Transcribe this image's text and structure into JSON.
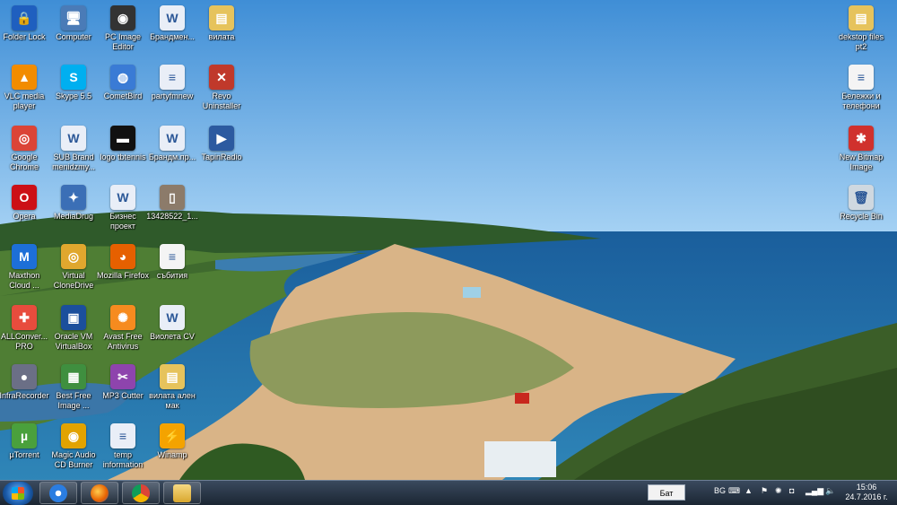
{
  "desktop": {
    "icons": [
      {
        "label": "Folder Lock",
        "icon": "folder-lock-icon",
        "color": "#1f5fbf",
        "glyph": "🔒"
      },
      {
        "label": "Computer",
        "icon": "computer-icon",
        "color": "#4a7bb7",
        "glyph": "🖥"
      },
      {
        "label": "PC Image Editor",
        "icon": "pc-image-editor-icon",
        "color": "#333333",
        "glyph": "◉"
      },
      {
        "label": "Брандмен...",
        "icon": "word-document-icon",
        "color": "#e9eef7",
        "glyph": "W"
      },
      {
        "label": "вилата",
        "icon": "folder-icon",
        "color": "#e6c35c",
        "glyph": "▤"
      },
      {
        "label": "VLC media player",
        "icon": "vlc-icon",
        "color": "#f28c00",
        "glyph": "▲"
      },
      {
        "label": "Skype 5.5",
        "icon": "skype-icon",
        "color": "#00aff0",
        "glyph": "S"
      },
      {
        "label": "CometBird",
        "icon": "cometbird-icon",
        "color": "#3a7bd5",
        "glyph": "◍"
      },
      {
        "label": "partyfmnew",
        "icon": "document-icon",
        "color": "#e9eef7",
        "glyph": "≡"
      },
      {
        "label": "Revo Uninstaller",
        "icon": "revo-uninstaller-icon",
        "color": "#c0392b",
        "glyph": "✕"
      },
      {
        "label": "Google Chrome",
        "icon": "chrome-icon",
        "color": "#db4437",
        "glyph": "◎"
      },
      {
        "label": "SUB Brand menidzmy...",
        "icon": "word-document-icon",
        "color": "#e9eef7",
        "glyph": "W"
      },
      {
        "label": "logo tbtennis",
        "icon": "image-file-icon",
        "color": "#111111",
        "glyph": "▬"
      },
      {
        "label": "Брандм.пр...",
        "icon": "word-document-icon",
        "color": "#e9eef7",
        "glyph": "W"
      },
      {
        "label": "TapinRadio",
        "icon": "tapinradio-icon",
        "color": "#2c5aa0",
        "glyph": "▶"
      },
      {
        "label": "Opera",
        "icon": "opera-icon",
        "color": "#cc0f16",
        "glyph": "O"
      },
      {
        "label": "MediaDrug",
        "icon": "mediadrug-icon",
        "color": "#3b6fb6",
        "glyph": "✦"
      },
      {
        "label": "Бизнес проект",
        "icon": "word-document-icon",
        "color": "#e9eef7",
        "glyph": "W"
      },
      {
        "label": "13428522_1...",
        "icon": "image-file-icon",
        "color": "#8c7b6a",
        "glyph": "▯"
      },
      {
        "label": "Maxthon Cloud ...",
        "icon": "maxthon-icon",
        "color": "#1d6fd8",
        "glyph": "M"
      },
      {
        "label": "Virtual CloneDrive",
        "icon": "virtual-clonedrive-icon",
        "color": "#e0a72e",
        "glyph": "◎"
      },
      {
        "label": "Mozilla Firefox",
        "icon": "firefox-icon",
        "color": "#e66000",
        "glyph": "◕"
      },
      {
        "label": "събития",
        "icon": "document-icon",
        "color": "#f4f4f4",
        "glyph": "≡"
      },
      {
        "label": "ALLConver... PRO",
        "icon": "allconverter-icon",
        "color": "#e84c3d",
        "glyph": "✚"
      },
      {
        "label": "Oracle VM VirtualBox",
        "icon": "virtualbox-icon",
        "color": "#1b4f9c",
        "glyph": "▣"
      },
      {
        "label": "Avast Free Antivirus",
        "icon": "avast-icon",
        "color": "#f68b1f",
        "glyph": "✺"
      },
      {
        "label": "Виолета CV",
        "icon": "word-document-icon",
        "color": "#e9eef7",
        "glyph": "W"
      },
      {
        "label": "InfraRecorder",
        "icon": "infrarecorder-icon",
        "color": "#6b6f86",
        "glyph": "●"
      },
      {
        "label": "Best Free Image ...",
        "icon": "image-app-icon",
        "color": "#3f8f3f",
        "glyph": "▦"
      },
      {
        "label": "MP3 Cutter",
        "icon": "mp3-cutter-icon",
        "color": "#8e44ad",
        "glyph": "✂"
      },
      {
        "label": "вилата ален мак",
        "icon": "folder-icon",
        "color": "#e6c35c",
        "glyph": "▤"
      },
      {
        "label": "µTorrent",
        "icon": "utorrent-icon",
        "color": "#4aa03c",
        "glyph": "µ"
      },
      {
        "label": "Magic Audio CD Burner",
        "icon": "magic-audio-icon",
        "color": "#e2a300",
        "glyph": "◉"
      },
      {
        "label": "temp information",
        "icon": "document-icon",
        "color": "#e9eef7",
        "glyph": "≡"
      },
      {
        "label": "Winamp",
        "icon": "winamp-icon",
        "color": "#f4a300",
        "glyph": "⚡"
      },
      {
        "label": "dekstop files pt2",
        "icon": "folder-icon",
        "color": "#e6c35c",
        "glyph": "▤"
      },
      {
        "label": "Бележки и телефони",
        "icon": "text-file-icon",
        "color": "#f4f4f4",
        "glyph": "≡"
      },
      {
        "label": "New Bitmap Image",
        "icon": "bitmap-icon",
        "color": "#d0312d",
        "glyph": "✱"
      },
      {
        "label": "Recycle Bin",
        "icon": "recycle-bin-icon",
        "color": "#cfd8e0",
        "glyph": "🗑"
      }
    ]
  },
  "taskbar": {
    "pinned": [
      {
        "name": "windows-media-player-icon",
        "color": "#2a7de1"
      },
      {
        "name": "firefox-icon",
        "color": "#e66000"
      },
      {
        "name": "chrome-icon",
        "color": "#db4437"
      },
      {
        "name": "explorer-folder-icon",
        "color": "#e6c35c"
      }
    ],
    "language_label": "Бат",
    "lang_code": "BG",
    "clock": {
      "time": "15:06",
      "date": "24.7.2016 г."
    }
  }
}
